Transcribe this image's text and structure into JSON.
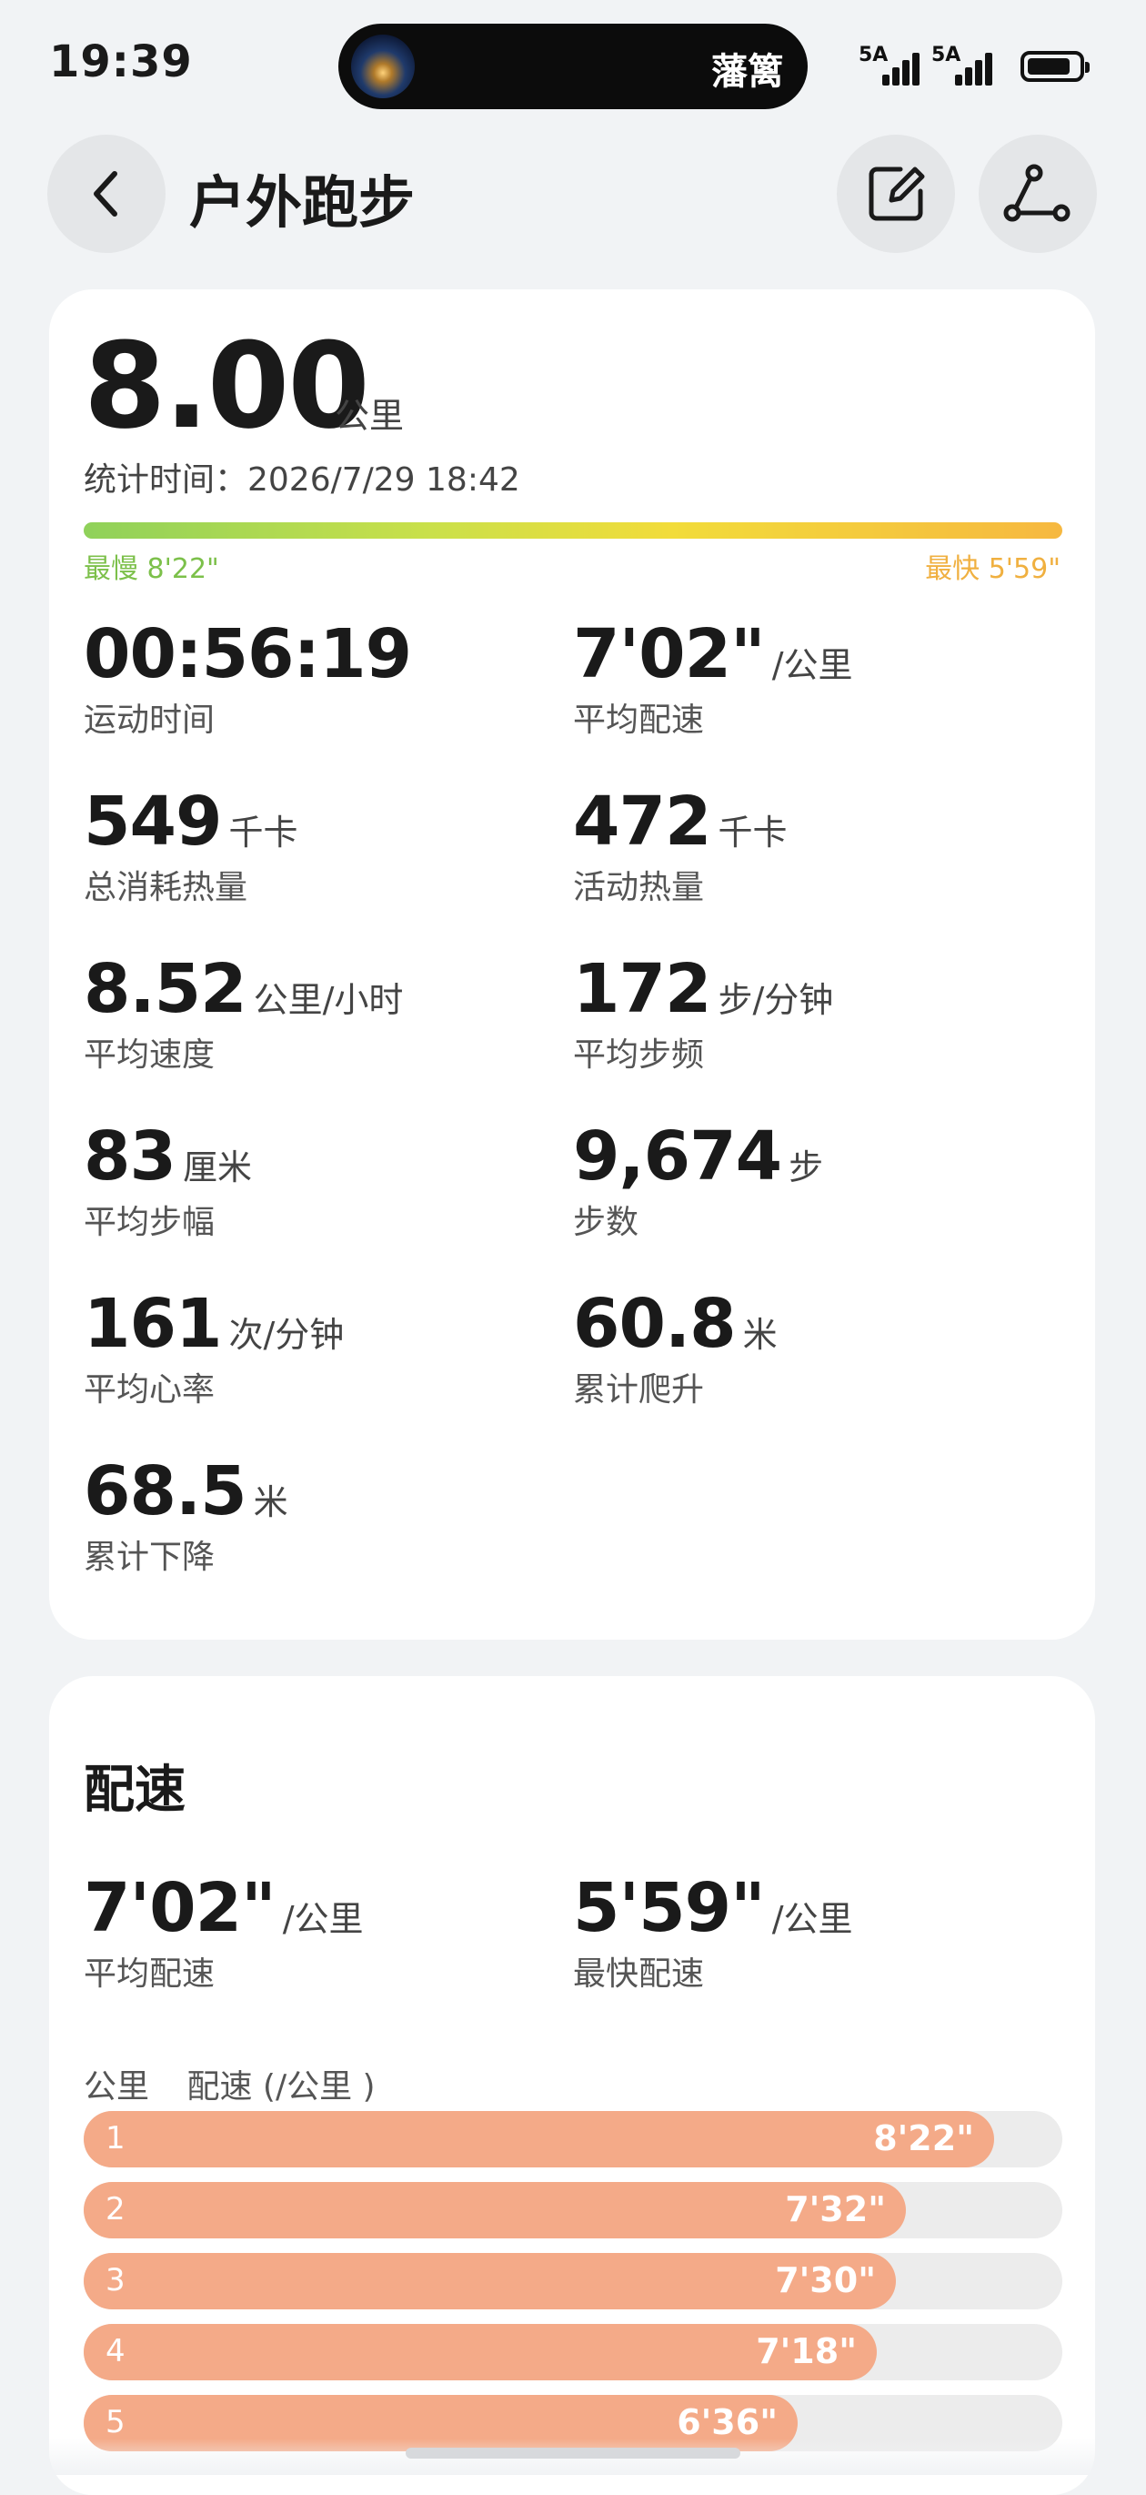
{
  "status_bar": {
    "time": "19:39",
    "island_text": "藩篱",
    "signal_1": "5A",
    "signal_2": "5A",
    "battery_level": 0.85
  },
  "header": {
    "title": "户外跑步",
    "back_icon": "chevron-left-icon",
    "edit_icon": "edit-icon",
    "share_icon": "route-icon"
  },
  "summary": {
    "distance": "8.00",
    "distance_unit": "公里",
    "stat_time": "统计时间：2026/7/29 18:42",
    "slowest": "最慢 8'22\"",
    "fastest": "最快 5'59\"",
    "metrics": [
      {
        "value": "00:56:19",
        "unit": "",
        "label": "运动时间"
      },
      {
        "value": "7'02\"",
        "unit": "/公里",
        "label": "平均配速"
      },
      {
        "value": "549",
        "unit": "千卡",
        "label": "总消耗热量"
      },
      {
        "value": "472",
        "unit": "千卡",
        "label": "活动热量"
      },
      {
        "value": "8.52",
        "unit": "公里/小时",
        "label": "平均速度"
      },
      {
        "value": "172",
        "unit": "步/分钟",
        "label": "平均步频"
      },
      {
        "value": "83",
        "unit": "厘米",
        "label": "平均步幅"
      },
      {
        "value": "9,674",
        "unit": "步",
        "label": "步数"
      },
      {
        "value": "161",
        "unit": "次/分钟",
        "label": "平均心率"
      },
      {
        "value": "60.8",
        "unit": "米",
        "label": "累计爬升"
      },
      {
        "value": "68.5",
        "unit": "米",
        "label": "累计下降"
      }
    ]
  },
  "pace_section": {
    "title": "配速",
    "avg_value": "7'02\"",
    "avg_unit": "/公里",
    "avg_label": "平均配速",
    "fast_value": "5'59\"",
    "fast_unit": "/公里",
    "fast_label": "最快配速",
    "col_km": "公里",
    "col_pace": "配速 (/公里 )",
    "splits": [
      {
        "km": "1",
        "pace": "8'22\"",
        "ratio": 0.93
      },
      {
        "km": "2",
        "pace": "7'32\"",
        "ratio": 0.84
      },
      {
        "km": "3",
        "pace": "7'30\"",
        "ratio": 0.83
      },
      {
        "km": "4",
        "pace": "7'18\"",
        "ratio": 0.81
      },
      {
        "km": "5",
        "pace": "6'36\"",
        "ratio": 0.73
      }
    ]
  }
}
